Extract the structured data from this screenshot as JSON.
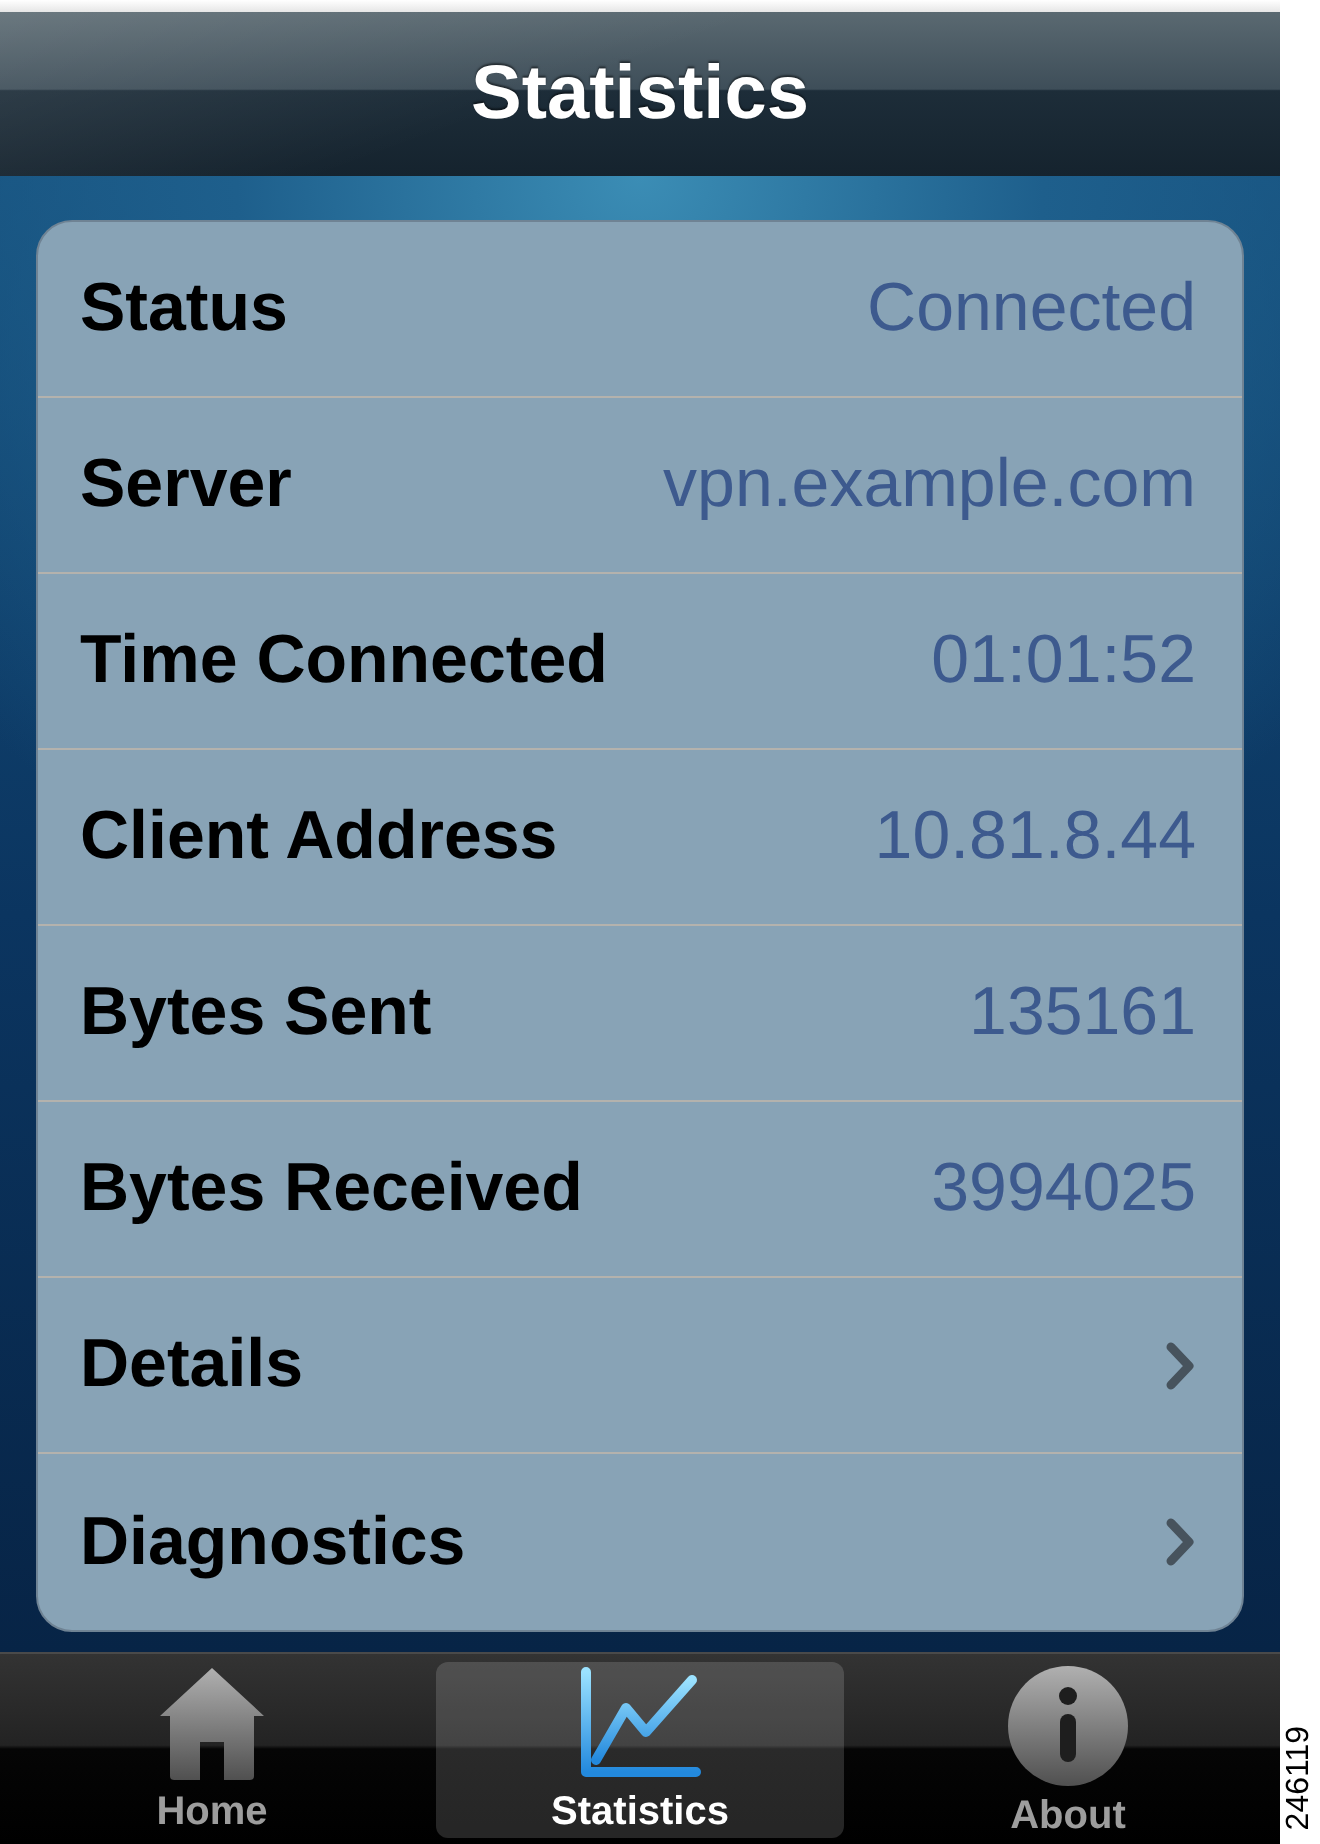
{
  "header": {
    "title": "Statistics"
  },
  "rows": [
    {
      "kind": "value",
      "label": "Status",
      "value": "Connected"
    },
    {
      "kind": "value",
      "label": "Server",
      "value": "vpn.example.com"
    },
    {
      "kind": "value",
      "label": "Time Connected",
      "value": "01:01:52"
    },
    {
      "kind": "value",
      "label": "Client Address",
      "value": "10.81.8.44"
    },
    {
      "kind": "value",
      "label": "Bytes Sent",
      "value": "135161"
    },
    {
      "kind": "value",
      "label": "Bytes Received",
      "value": "3994025"
    },
    {
      "kind": "link",
      "label": "Details"
    },
    {
      "kind": "link",
      "label": "Diagnostics"
    }
  ],
  "tab_bar": [
    {
      "label": "Home",
      "selected": false
    },
    {
      "label": "Statistics",
      "selected": true
    },
    {
      "label": "About",
      "selected": false
    }
  ],
  "figure_number": "246119"
}
